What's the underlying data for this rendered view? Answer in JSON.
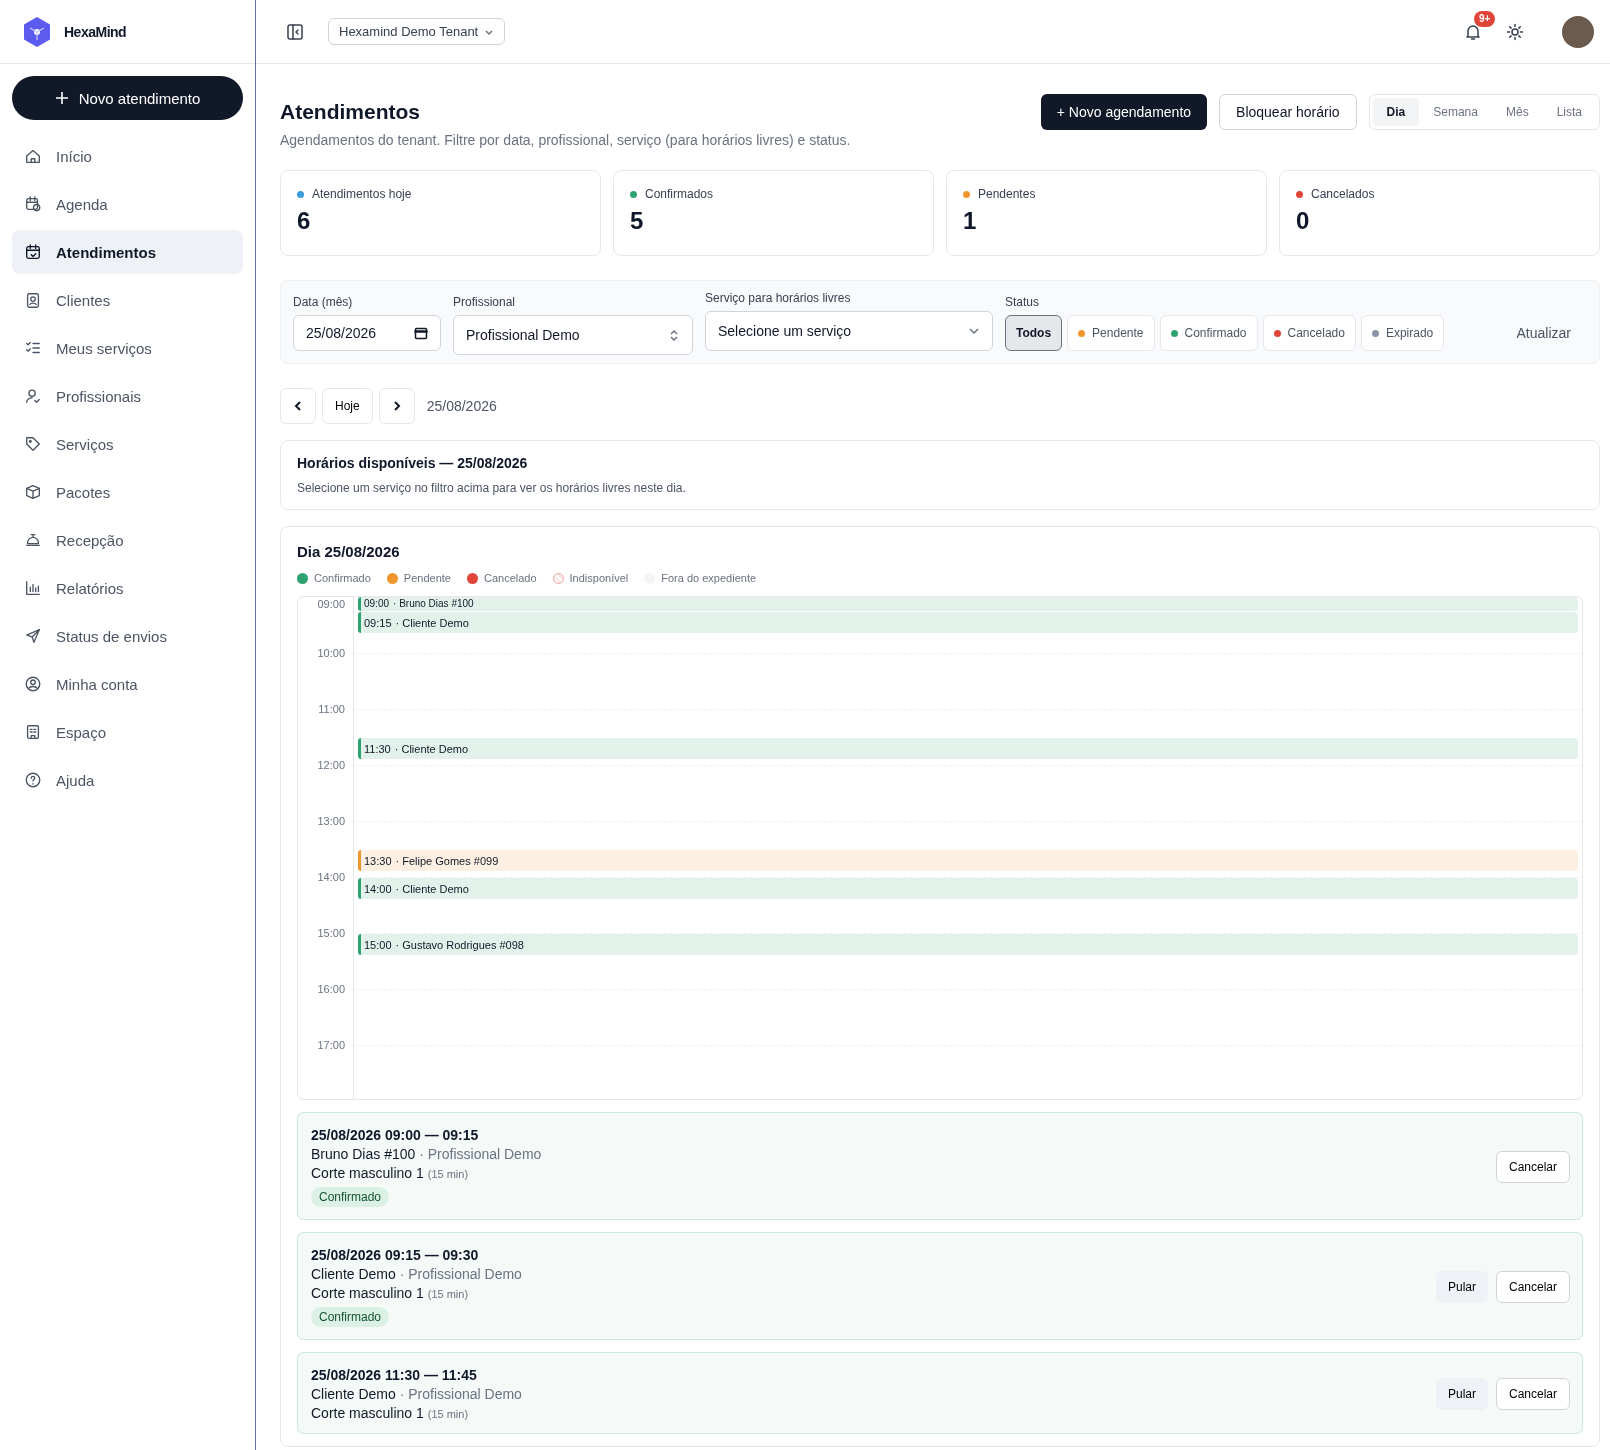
{
  "brand": {
    "name": "HexaMind"
  },
  "sidebar": {
    "new_button": "Novo atendimento",
    "items": [
      {
        "label": "Início",
        "selected": false
      },
      {
        "label": "Agenda",
        "selected": false
      },
      {
        "label": "Atendimentos",
        "selected": true
      },
      {
        "label": "Clientes",
        "selected": false
      },
      {
        "label": "Meus serviços",
        "selected": false
      },
      {
        "label": "Profissionais",
        "selected": false
      },
      {
        "label": "Serviços",
        "selected": false
      },
      {
        "label": "Pacotes",
        "selected": false
      },
      {
        "label": "Recepção",
        "selected": false
      },
      {
        "label": "Relatórios",
        "selected": false
      },
      {
        "label": "Status de envios",
        "selected": false
      },
      {
        "label": "Minha conta",
        "selected": false
      },
      {
        "label": "Espaço",
        "selected": false
      },
      {
        "label": "Ajuda",
        "selected": false
      }
    ]
  },
  "topbar": {
    "tenant": "Hexamind Demo Tenant",
    "notification_badge": "9+"
  },
  "page": {
    "title": "Atendimentos",
    "subtitle": "Agendamentos do tenant. Filtre por data, profissional, serviço (para horários livres) e status.",
    "actions": [
      {
        "label": "+ Novo agendamento",
        "kind": "primary"
      },
      {
        "label": "Bloquear horário",
        "kind": "outline"
      }
    ],
    "view_tabs": [
      {
        "label": "Dia",
        "selected": true
      },
      {
        "label": "Semana",
        "selected": false
      },
      {
        "label": "Mês",
        "selected": false
      },
      {
        "label": "Lista",
        "selected": false
      }
    ]
  },
  "stats": [
    {
      "label": "Atendimentos hoje",
      "value": "6",
      "color": "#3b9ce0"
    },
    {
      "label": "Confirmados",
      "value": "5",
      "color": "#2fa36f"
    },
    {
      "label": "Pendentes",
      "value": "1",
      "color": "#f0962e"
    },
    {
      "label": "Cancelados",
      "value": "0",
      "color": "#e0453a"
    }
  ],
  "filters": {
    "date": {
      "label": "Data (mês)",
      "value": "25/08/2026"
    },
    "professional": {
      "label": "Profissional",
      "value": "Profissional Demo"
    },
    "service": {
      "label": "Serviço para horários livres",
      "placeholder": "Selecione um serviço"
    },
    "status": {
      "label": "Status",
      "options": [
        {
          "label": "Todos",
          "selected": true
        },
        {
          "label": "Pendente",
          "selected": false,
          "color": "#f0962e"
        },
        {
          "label": "Confirmado",
          "selected": false,
          "color": "#2fa36f"
        },
        {
          "label": "Cancelado",
          "selected": false,
          "color": "#e0453a"
        },
        {
          "label": "Expirado",
          "selected": false,
          "color": "#8a94a6"
        }
      ]
    },
    "refresh": "Atualizar"
  },
  "date_nav": {
    "today": "Hoje",
    "current": "25/08/2026"
  },
  "availability": {
    "title": "Horários disponíveis — 25/08/2026",
    "message": "Selecione um serviço no filtro acima para ver os horários livres neste dia."
  },
  "day": {
    "title": "Dia 25/08/2026",
    "legend": [
      {
        "label": "Confirmado",
        "kind": "dot",
        "color": "#2fa36f"
      },
      {
        "label": "Pendente",
        "kind": "dot",
        "color": "#f0962e"
      },
      {
        "label": "Cancelado",
        "kind": "dot",
        "color": "#e0453a"
      },
      {
        "label": "Indisponível",
        "kind": "hatched"
      },
      {
        "label": "Fora do expediente",
        "kind": "faint"
      }
    ],
    "hours": [
      "09:00",
      "10:00",
      "11:00",
      "12:00",
      "13:00",
      "14:00",
      "15:00",
      "16:00",
      "17:00"
    ],
    "events": [
      {
        "time": "09:00",
        "name": "· Bruno Dias #100",
        "color": "#2fa36f"
      },
      {
        "time": "09:15",
        "name": "· Cliente Demo",
        "color": "#2fa36f"
      },
      {
        "time": "11:30",
        "name": "· Cliente Demo",
        "color": "#2fa36f"
      },
      {
        "time": "13:30",
        "name": "· Felipe Gomes #099",
        "color": "#f0962e"
      },
      {
        "time": "14:00",
        "name": "· Cliente Demo",
        "color": "#2fa36f"
      },
      {
        "time": "15:00",
        "name": "· Gustavo Rodrigues #098",
        "color": "#2fa36f"
      }
    ]
  },
  "appointments": [
    {
      "when": "25/08/2026 09:00 — 09:15",
      "client": "Bruno Dias #100",
      "professional": "· Profissional Demo",
      "service": "Corte masculino 1",
      "duration": "(15 min)",
      "status": {
        "label": "Confirmado",
        "kind": "confirmed"
      },
      "actions": [
        {
          "label": "Cancelar",
          "kind": "outline"
        }
      ]
    },
    {
      "when": "25/08/2026 09:15 — 09:30",
      "client": "Cliente Demo",
      "professional": "· Profissional Demo",
      "service": "Corte masculino 1",
      "duration": "(15 min)",
      "status": {
        "label": "Confirmado",
        "kind": "confirmed"
      },
      "actions": [
        {
          "label": "Pular",
          "kind": "ghost"
        },
        {
          "label": "Cancelar",
          "kind": "outline"
        }
      ]
    },
    {
      "when": "25/08/2026 11:30 — 11:45",
      "client": "Cliente Demo",
      "professional": "· Profissional Demo",
      "service": "Corte masculino 1",
      "duration": "(15 min)",
      "actions": [
        {
          "label": "Pular",
          "kind": "ghost"
        },
        {
          "label": "Cancelar",
          "kind": "outline"
        }
      ]
    }
  ]
}
